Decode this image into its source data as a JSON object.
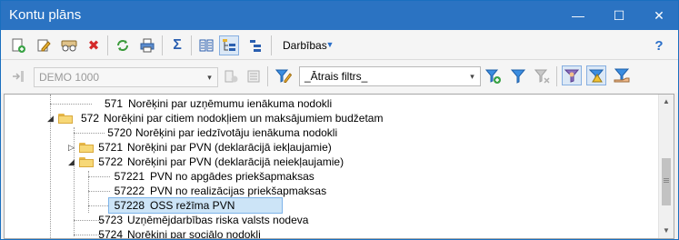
{
  "window": {
    "title": "Kontu plāns"
  },
  "window_controls": {
    "minimize": "—",
    "maximize": "☐",
    "close": "✕"
  },
  "toolbar": {
    "actions_label": "Darbības",
    "help_symbol": "?"
  },
  "toolbar2": {
    "database_value": "DEMO 1000",
    "filter_value": "_Ātrais filtrs_"
  },
  "tree": {
    "rows": [
      {
        "code": "571",
        "name": "Norēķini par uzņēmumu ienākuma nodokli",
        "level": 1,
        "type": "leaf"
      },
      {
        "code": "572",
        "name": "Norēķini par citiem nodokļiem un maksājumiem budžetam",
        "level": 1,
        "type": "folder-open"
      },
      {
        "code": "5720",
        "name": "Norēķini par iedzīvotāju ienākuma nodokli",
        "level": 2,
        "type": "leaf"
      },
      {
        "code": "5721",
        "name": "Norēķini par PVN (deklarācijā iekļaujamie)",
        "level": 2,
        "type": "folder-closed"
      },
      {
        "code": "5722",
        "name": "Norēķini par PVN (deklarācijā neiekļaujamie)",
        "level": 2,
        "type": "folder-open"
      },
      {
        "code": "57221",
        "name": "PVN no apgādes priekšapmaksas",
        "level": 3,
        "type": "leaf"
      },
      {
        "code": "57222",
        "name": "PVN no realizācijas priekšapmaksas",
        "level": 3,
        "type": "leaf"
      },
      {
        "code": "57228",
        "name": "OSS režīma PVN",
        "level": 3,
        "type": "leaf",
        "selected": true
      },
      {
        "code": "5723",
        "name": "Uzņēmējdarbības riska valsts nodeva",
        "level": 2,
        "type": "leaf"
      },
      {
        "code": "5724",
        "name": "Norēķini par sociālo nodokli",
        "level": 2,
        "type": "leaf"
      }
    ]
  },
  "colors": {
    "titlebar": "#2b73c2",
    "selection": "#cce4f7",
    "folder": "#f7d877"
  }
}
